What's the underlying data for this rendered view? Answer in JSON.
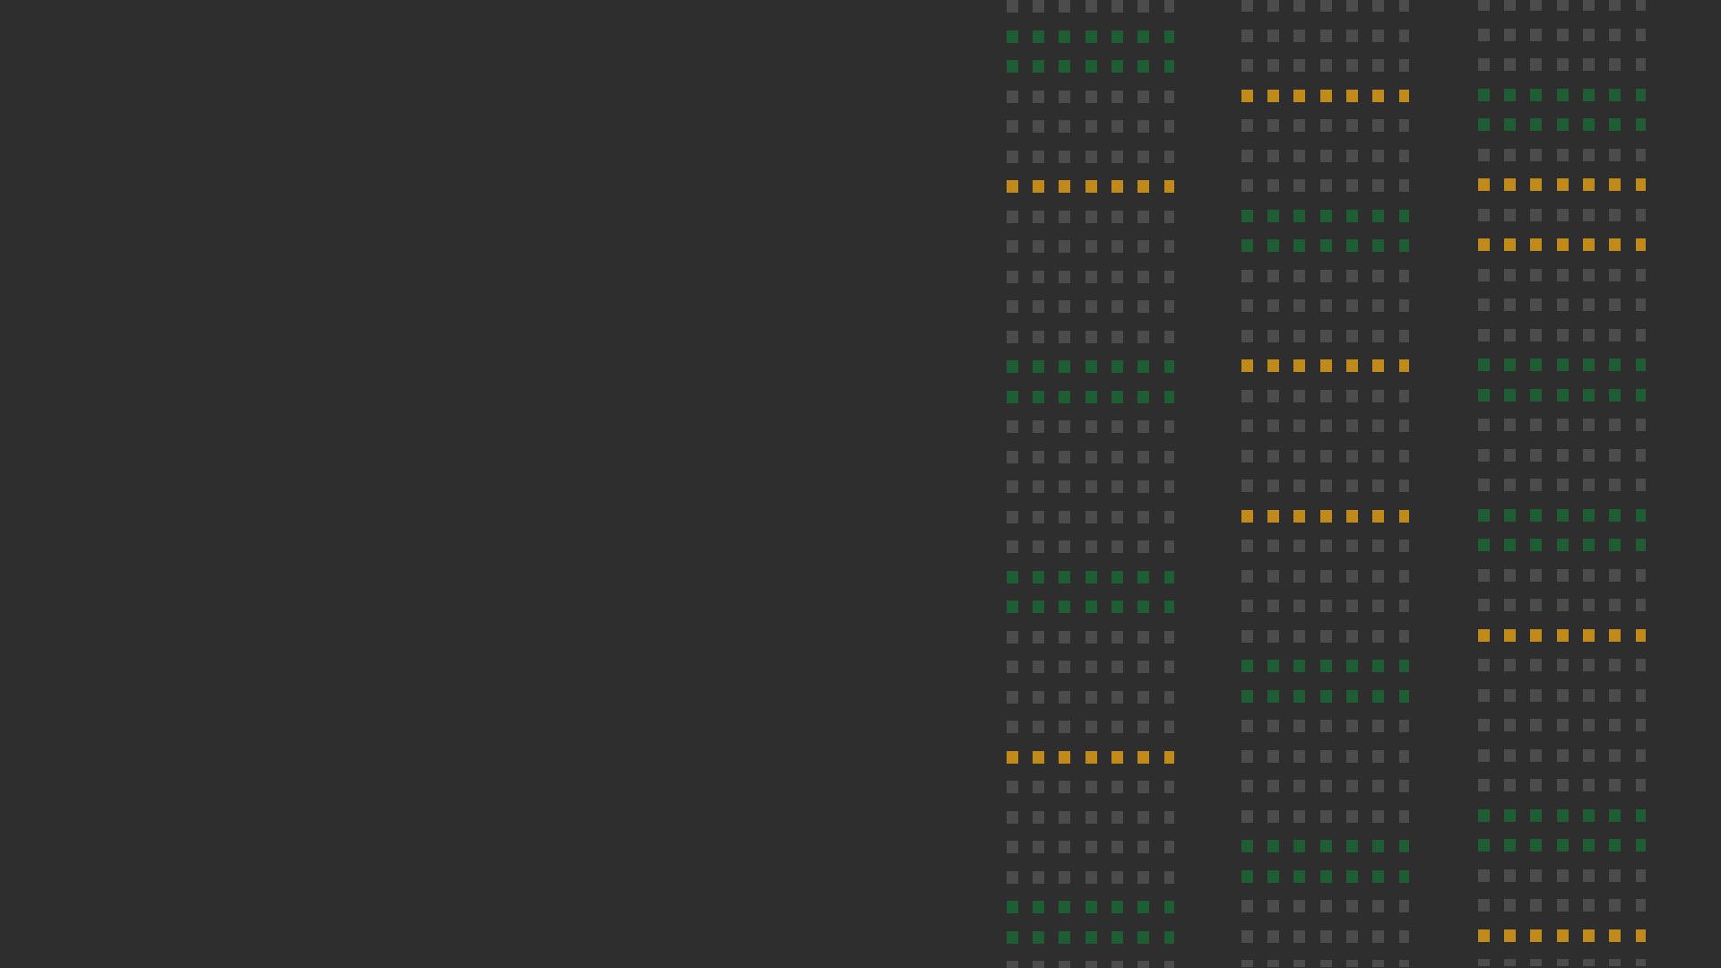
{
  "colors": {
    "background": "#2e2e2e",
    "idle": "#4c4c4c",
    "active": "#1f5e35",
    "highlight": "#c08b1a"
  },
  "strips": [
    {
      "name": "strip-1",
      "rows": [
        "idle",
        "active",
        "active",
        "idle",
        "idle",
        "idle",
        "highlight",
        "idle",
        "idle",
        "idle",
        "idle",
        "idle",
        "active",
        "active",
        "idle",
        "idle",
        "idle",
        "idle",
        "idle",
        "active",
        "active",
        "idle",
        "idle",
        "idle",
        "idle",
        "highlight",
        "idle",
        "idle",
        "idle",
        "idle",
        "active",
        "active",
        "idle"
      ]
    },
    {
      "name": "strip-2",
      "rows": [
        "idle",
        "idle",
        "idle",
        "highlight",
        "idle",
        "idle",
        "idle",
        "active",
        "active",
        "idle",
        "idle",
        "idle",
        "highlight",
        "idle",
        "idle",
        "idle",
        "idle",
        "highlight",
        "idle",
        "idle",
        "idle",
        "idle",
        "active",
        "active",
        "idle",
        "idle",
        "idle",
        "idle",
        "active",
        "active",
        "idle",
        "idle",
        "idle"
      ]
    },
    {
      "name": "strip-3",
      "rows": [
        "idle",
        "idle",
        "idle",
        "active",
        "active",
        "idle",
        "highlight",
        "idle",
        "highlight",
        "idle",
        "idle",
        "idle",
        "active",
        "active",
        "idle",
        "idle",
        "idle",
        "active",
        "active",
        "idle",
        "idle",
        "highlight",
        "idle",
        "idle",
        "idle",
        "idle",
        "idle",
        "active",
        "active",
        "idle",
        "idle",
        "highlight",
        "idle"
      ]
    }
  ]
}
